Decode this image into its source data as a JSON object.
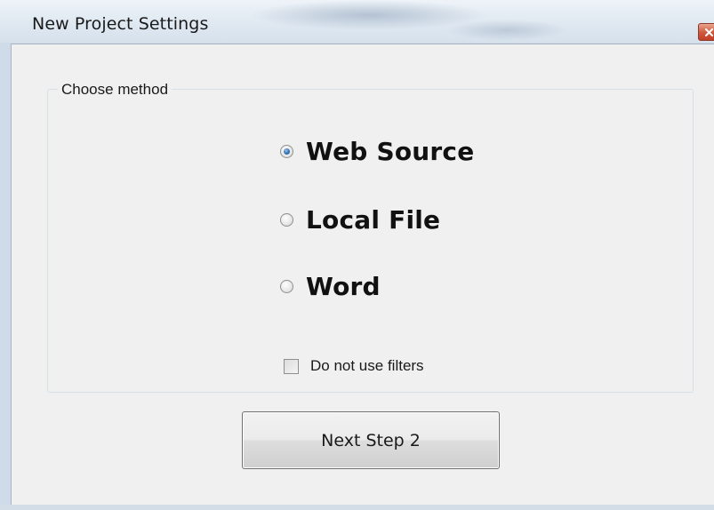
{
  "window": {
    "title": "New Project Settings",
    "close_icon": "close-x-icon"
  },
  "group": {
    "label": "Choose method"
  },
  "methods": [
    {
      "label": "Web Source",
      "selected": true
    },
    {
      "label": "Local File",
      "selected": false
    },
    {
      "label": "Word",
      "selected": false
    }
  ],
  "filters": {
    "label": "Do not use filters",
    "checked": false
  },
  "actions": {
    "next_label": "Next Step 2"
  },
  "colors": {
    "accent": "#2f6fb0",
    "close_button": "#d0563b"
  }
}
